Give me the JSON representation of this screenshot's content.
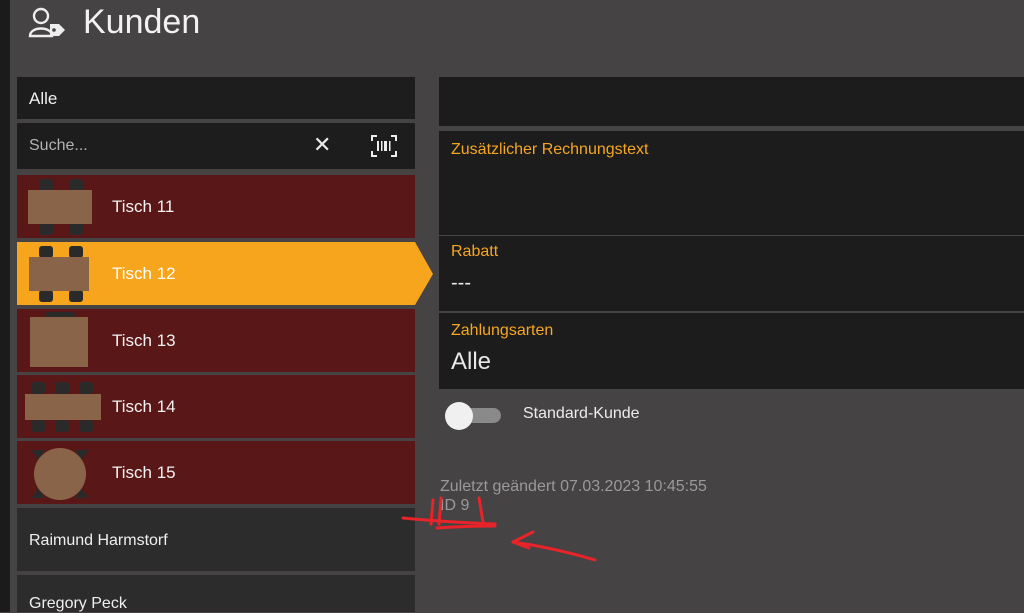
{
  "header": {
    "title": "Kunden",
    "icon": "customer-tag-icon"
  },
  "left": {
    "filter_label": "Alle",
    "search": {
      "placeholder": "Suche...",
      "clear_glyph": "✕",
      "barcode_icon": "barcode-scan-icon"
    },
    "tables": [
      {
        "label": "Tisch 11",
        "selected": false
      },
      {
        "label": "Tisch 12",
        "selected": true
      },
      {
        "label": "Tisch 13",
        "selected": false
      },
      {
        "label": "Tisch 14",
        "selected": false
      },
      {
        "label": "Tisch 15",
        "selected": false
      }
    ],
    "customers": [
      {
        "label": "Raimund Harmstorf"
      },
      {
        "label": "Gregory  Peck"
      }
    ]
  },
  "detail": {
    "invoice_text": {
      "caption": "Zusätzlicher Rechnungstext",
      "value": ""
    },
    "discount": {
      "caption": "Rabatt",
      "value": "---"
    },
    "payment": {
      "caption": "Zahlungsarten",
      "value": "Alle"
    },
    "standard_customer": {
      "label": "Standard-Kunde",
      "on": false
    },
    "last_modified": "Zuletzt geändert 07.03.2023 10:45:55",
    "id_text": "ID 9"
  },
  "colors": {
    "accent": "#f7a51c",
    "table_row": "#5a1718",
    "caption": "#f5a623",
    "annotation": "#e8232a"
  }
}
